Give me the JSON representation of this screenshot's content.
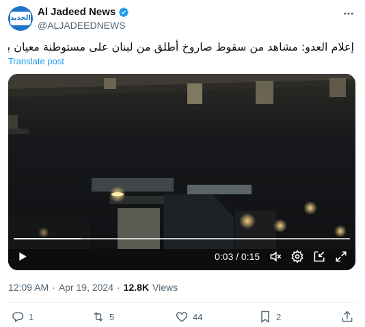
{
  "account": {
    "display_name": "Al Jadeed News",
    "handle": "@ALJADEEDNEWS",
    "avatar_text": "الجديد",
    "verified": true
  },
  "post": {
    "text": "إعلام العدو: مشاهد من سقوط صاروخ أُطلق من لبنان على مستوطنة معيان باروخ",
    "translate_label": "Translate post"
  },
  "video": {
    "time_display": "0:03 / 0:15",
    "progress": 0.2
  },
  "meta": {
    "time": "12:09 AM",
    "separator": "·",
    "date": "Apr 19, 2024",
    "views_count": "12.8K",
    "views_label": "Views"
  },
  "actions": {
    "replies": "1",
    "reposts": "5",
    "likes": "44",
    "bookmarks": "2"
  },
  "colors": {
    "link": "#1d9bf0",
    "verified": "#1d9bf0",
    "avatar_bg": "#1e73c8",
    "secondary_text": "#536471"
  }
}
